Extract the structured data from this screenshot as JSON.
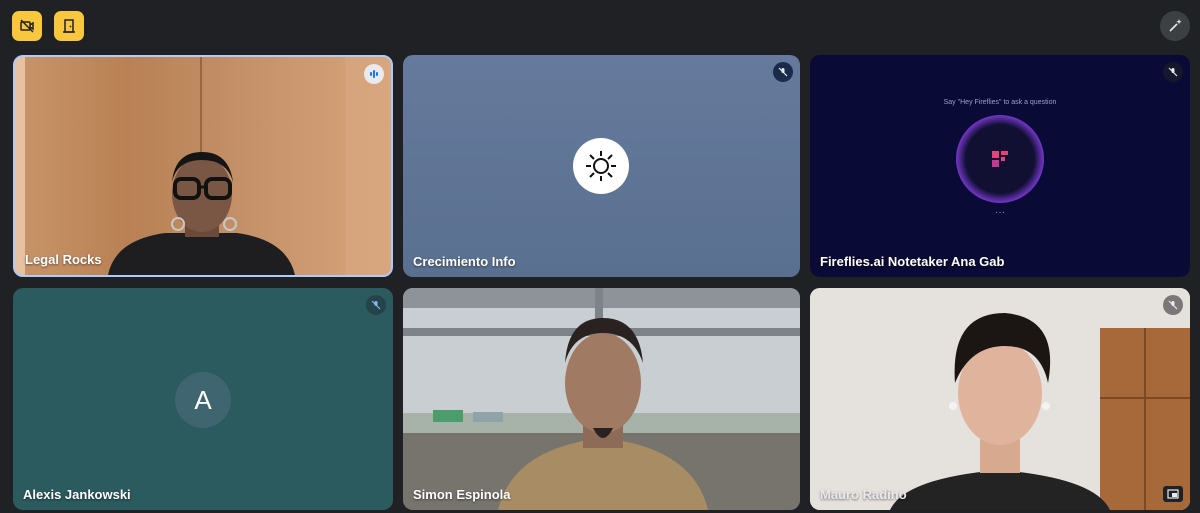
{
  "toolbar": {
    "left_buttons": [
      {
        "icon": "camera-off-icon"
      },
      {
        "icon": "door-exit-icon"
      }
    ],
    "right_button": {
      "icon": "pen-sparkle-icon"
    }
  },
  "participants": [
    {
      "name": "Legal Rocks",
      "mic": "speaking"
    },
    {
      "name": "Crecimiento Info",
      "mic": "muted"
    },
    {
      "name": "Fireflies.ai Notetaker Ana Gab",
      "mic": "muted",
      "prompt": "Say \"Hey Fireflies\" to ask a question",
      "dots": "···"
    },
    {
      "name": "Alexis Jankowski",
      "mic": "muted",
      "initial": "A"
    },
    {
      "name": "Simon Espinola",
      "mic": "none"
    },
    {
      "name": "Mauro Radino",
      "mic": "muted"
    }
  ],
  "colors": {
    "accent": "#f9c73d",
    "active_border": "#aecbfa",
    "background": "#202124"
  }
}
